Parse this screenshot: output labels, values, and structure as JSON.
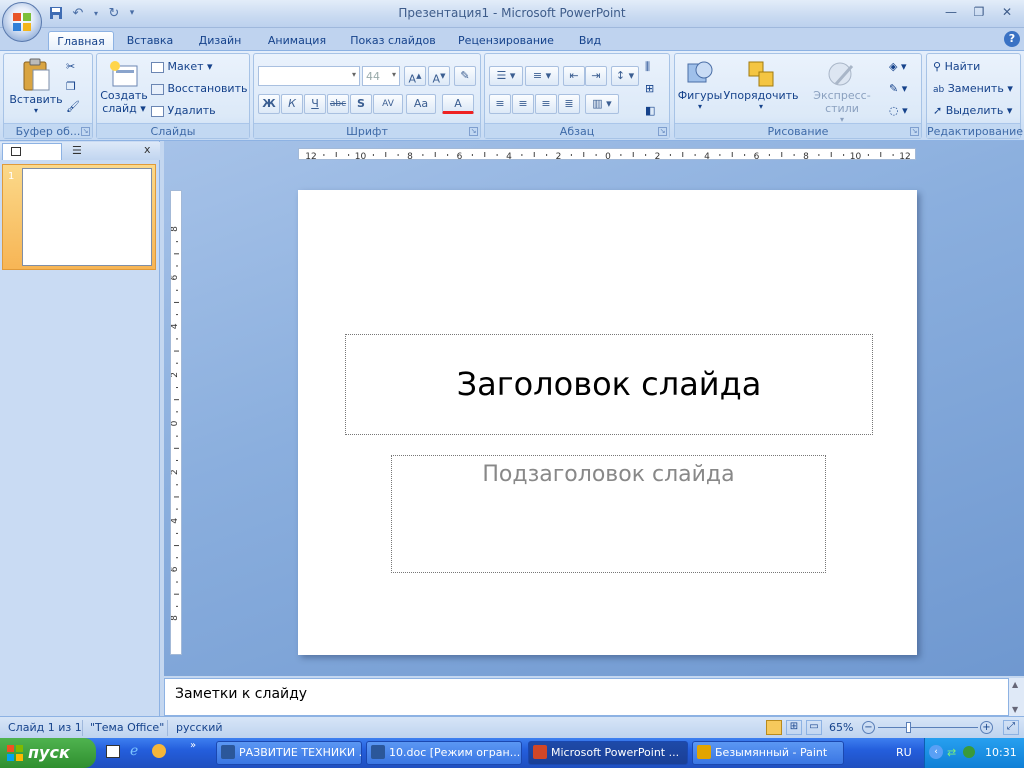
{
  "window": {
    "title": "Презентация1 - Microsoft PowerPoint"
  },
  "tabs": [
    {
      "label": "Главная",
      "active": true
    },
    {
      "label": "Вставка"
    },
    {
      "label": "Дизайн"
    },
    {
      "label": "Анимация"
    },
    {
      "label": "Показ слайдов"
    },
    {
      "label": "Рецензирование"
    },
    {
      "label": "Вид"
    }
  ],
  "ribbon": {
    "clipboard": {
      "label": "Буфер об...",
      "paste": "Вставить"
    },
    "slides": {
      "label": "Слайды",
      "new_slide_1": "Создать",
      "new_slide_2": "слайд",
      "layout": "Макет",
      "reset": "Восстановить",
      "delete": "Удалить"
    },
    "font": {
      "label": "Шрифт",
      "size": "44",
      "bold": "Ж",
      "italic": "К",
      "underline": "Ч",
      "strike": "abc",
      "shadow": "S",
      "spacing": "AV",
      "case": "Aa",
      "color": "A"
    },
    "paragraph": {
      "label": "Абзац"
    },
    "drawing": {
      "label": "Рисование",
      "shapes": "Фигуры",
      "arrange": "Упорядочить",
      "quick_styles": "Экспресс-стили"
    },
    "editing": {
      "label": "Редактирование",
      "find": "Найти",
      "replace": "Заменить",
      "select": "Выделить"
    }
  },
  "ruler": {
    "h_ticks": [
      "12",
      "10",
      "8",
      "6",
      "4",
      "2",
      "0",
      "2",
      "4",
      "6",
      "8",
      "10",
      "12"
    ],
    "v_ticks": [
      "8",
      "6",
      "4",
      "2",
      "0",
      "2",
      "4",
      "6",
      "8"
    ]
  },
  "slides_pane": {
    "thumb_number": "1"
  },
  "slide": {
    "title_placeholder": "Заголовок слайда",
    "subtitle_placeholder": "Подзаголовок слайда"
  },
  "notes": {
    "placeholder": "Заметки к слайду"
  },
  "status": {
    "slide_info": "Слайд 1 из 1",
    "theme": "\"Тема Office\"",
    "language": "русский",
    "zoom": "65%",
    "zoom_fraction": 0.3
  },
  "taskbar": {
    "start": "пуск",
    "items": [
      {
        "label": "РАЗВИТИЕ ТЕХНИКИ ...",
        "color": "#2b579a"
      },
      {
        "label": "10.doc [Режим огран...",
        "color": "#2b579a"
      },
      {
        "label": "Microsoft PowerPoint ...",
        "color": "#d24726",
        "active": true
      },
      {
        "label": "Безымянный - Paint",
        "color": "#e2a400"
      }
    ],
    "lang": "RU",
    "clock": "10:31"
  }
}
